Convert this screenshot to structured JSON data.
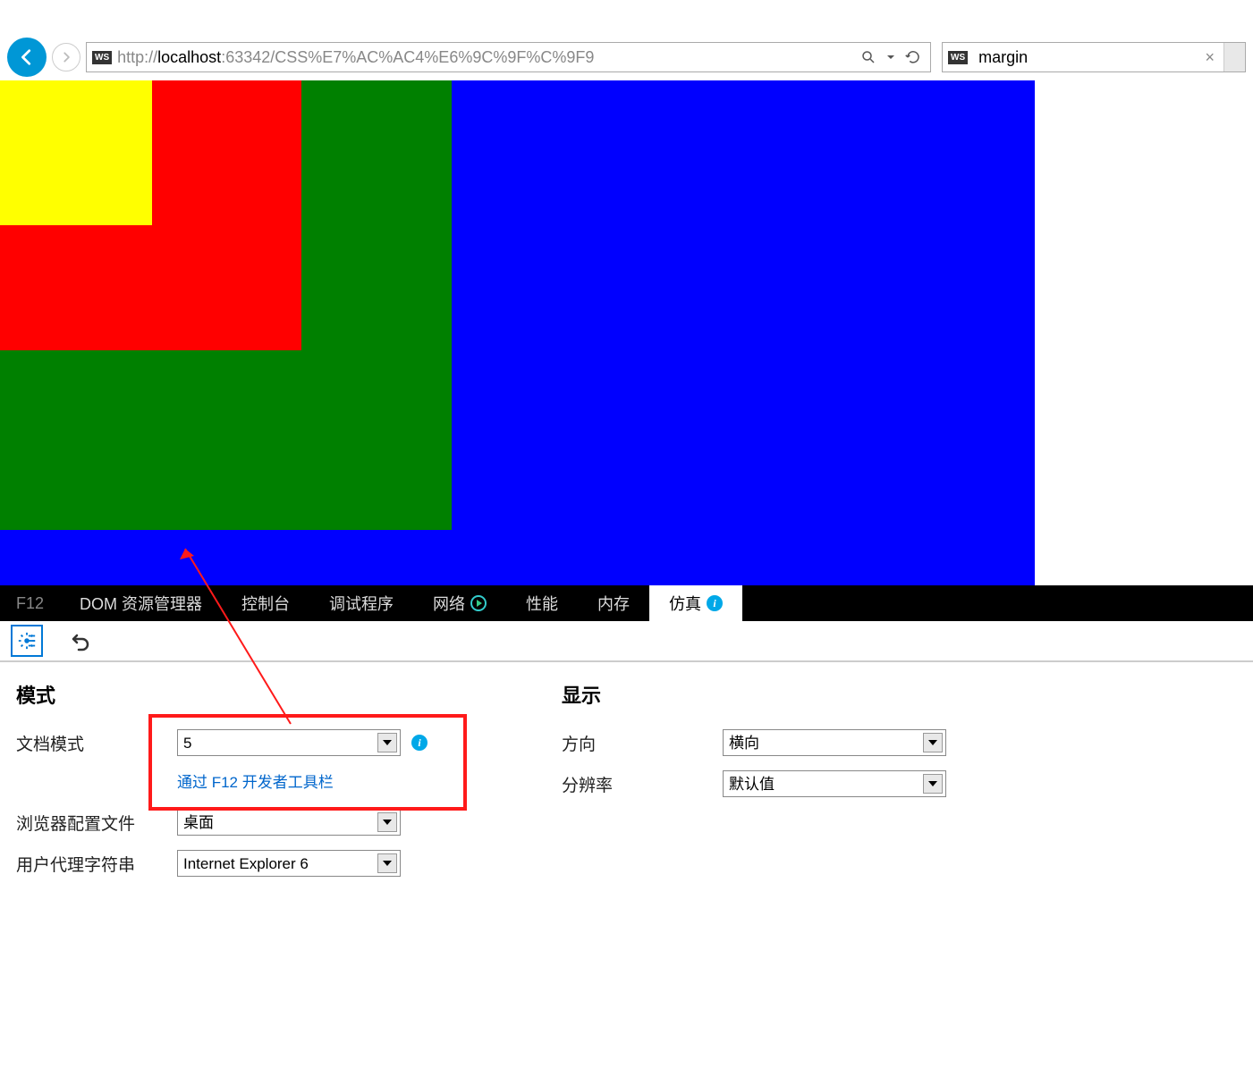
{
  "browser": {
    "url_proto": "http://",
    "url_host": "localhost",
    "url_rest": ":63342/CSS%E7%AC%AC4%E6%9C%9F%C%9F9",
    "tab_title": "margin",
    "ws_badge": "WS"
  },
  "devtools": {
    "tabs": {
      "f12": "F12",
      "dom": "DOM 资源管理器",
      "console": "控制台",
      "debugger": "调试程序",
      "network": "网络",
      "perf": "性能",
      "memory": "内存",
      "emulation": "仿真"
    }
  },
  "emulation": {
    "mode_heading": "模式",
    "display_heading": "显示",
    "doc_mode_label": "文档模式",
    "doc_mode_value": "5",
    "doc_mode_hint": "通过 F12 开发者工具栏",
    "browser_profile_label": "浏览器配置文件",
    "browser_profile_value": "桌面",
    "ua_label": "用户代理字符串",
    "ua_value": "Internet Explorer 6",
    "direction_label": "方向",
    "direction_value": "横向",
    "resolution_label": "分辨率",
    "resolution_value": "默认值"
  }
}
